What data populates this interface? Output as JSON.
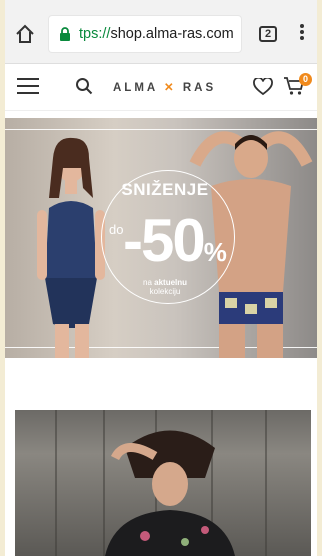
{
  "browser": {
    "url_scheme": "tps://",
    "url_host": "shop.alma-ras.com",
    "tab_count": "2"
  },
  "site": {
    "logo_left": "ALMA",
    "logo_x": "✕",
    "logo_right": "RAS",
    "cart_count": "0"
  },
  "hero": {
    "title": "SNIŽENJE",
    "prefix": "do",
    "discount": "-50",
    "percent": "%",
    "sub_line1": "na",
    "sub_bold": "aktuelnu",
    "sub_line2": "kolekciju"
  },
  "colors": {
    "accent": "#f08a1c",
    "lock_green": "#0a8a3d"
  },
  "icons": [
    "home-icon",
    "lock-icon",
    "tabs-icon",
    "overflow-menu-icon",
    "hamburger-icon",
    "search-icon",
    "heart-icon",
    "cart-icon"
  ]
}
